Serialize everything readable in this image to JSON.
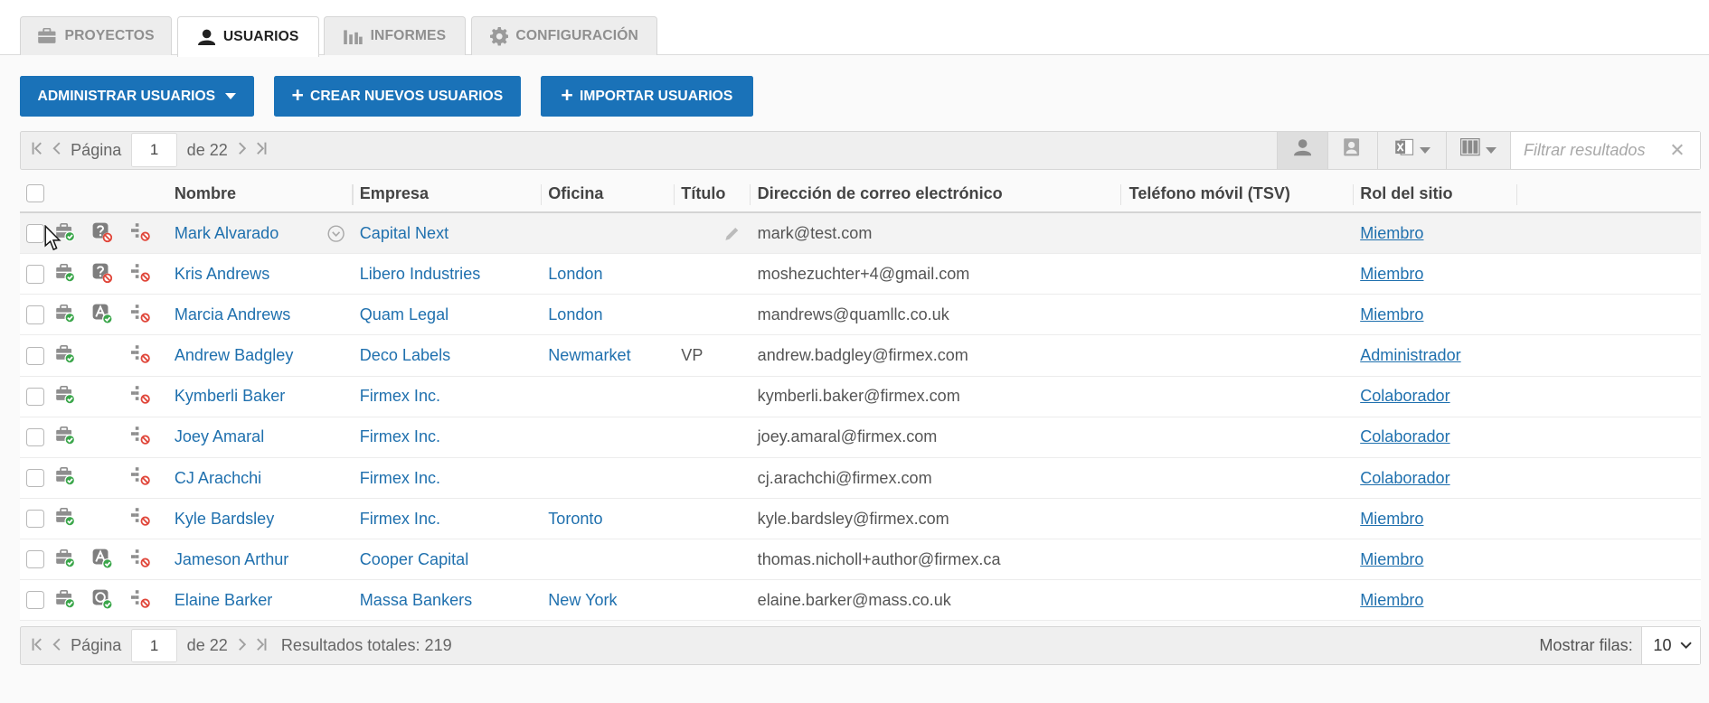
{
  "tabs": [
    {
      "label": "PROYECTOS",
      "icon": "briefcase-icon",
      "active": false
    },
    {
      "label": "USUARIOS",
      "icon": "user-icon",
      "active": true
    },
    {
      "label": "INFORMES",
      "icon": "bar-chart-icon",
      "active": false
    },
    {
      "label": "CONFIGURACIÓN",
      "icon": "gear-icon",
      "active": false
    }
  ],
  "actions": {
    "manage_label": "ADMINISTRAR USUARIOS",
    "create_label": "CREAR NUEVOS USUARIOS",
    "import_label": "IMPORTAR USUARIOS"
  },
  "pager_top": {
    "page_label": "Página",
    "page_value": "1",
    "of_label": "de 22"
  },
  "toolbar": {
    "filter_placeholder": "Filtrar resultados",
    "clear_glyph": "✕"
  },
  "columns": {
    "name": "Nombre",
    "company": "Empresa",
    "office": "Oficina",
    "title": "Título",
    "email": "Dirección de correo electrónico",
    "phone": "Teléfono móvil (TSV)",
    "role": "Rol del sitio"
  },
  "rows": [
    {
      "name": "Mark Alvarado",
      "company": "Capital Next",
      "office": "",
      "title": "",
      "email": "mark@test.com",
      "phone": "",
      "role": "Miembro",
      "status": "inactive"
    },
    {
      "name": "Kris Andrews",
      "company": "Libero Industries",
      "office": "London",
      "title": "",
      "email": "moshezuchter+4@gmail.com",
      "phone": "",
      "role": "Miembro",
      "status": "inactive"
    },
    {
      "name": "Marcia Andrews",
      "company": "Quam Legal",
      "office": "London",
      "title": "",
      "email": "mandrews@quamllc.co.uk",
      "phone": "",
      "role": "Miembro",
      "status": "author"
    },
    {
      "name": "Andrew Badgley",
      "company": "Deco Labels",
      "office": "Newmarket",
      "title": "VP",
      "email": "andrew.badgley@firmex.com",
      "phone": "",
      "role": "Administrador",
      "status": "none"
    },
    {
      "name": "Kymberli Baker",
      "company": "Firmex Inc.",
      "office": "",
      "title": "",
      "email": "kymberli.baker@firmex.com",
      "phone": "",
      "role": "Colaborador",
      "status": "none"
    },
    {
      "name": "Joey Amaral",
      "company": "Firmex Inc.",
      "office": "",
      "title": "",
      "email": "joey.amaral@firmex.com",
      "phone": "",
      "role": "Colaborador",
      "status": "none"
    },
    {
      "name": "CJ Arachchi",
      "company": "Firmex Inc.",
      "office": "",
      "title": "",
      "email": "cj.arachchi@firmex.com",
      "phone": "",
      "role": "Colaborador",
      "status": "none"
    },
    {
      "name": "Kyle Bardsley",
      "company": "Firmex Inc.",
      "office": "Toronto",
      "title": "",
      "email": "kyle.bardsley@firmex.com",
      "phone": "",
      "role": "Miembro",
      "status": "none"
    },
    {
      "name": "Jameson Arthur",
      "company": "Cooper Capital",
      "office": "",
      "title": "",
      "email": "thomas.nicholl+author@firmex.ca",
      "phone": "",
      "role": "Miembro",
      "status": "author"
    },
    {
      "name": "Elaine Barker",
      "company": "Massa Bankers",
      "office": "New York",
      "title": "",
      "email": "elaine.barker@mass.co.uk",
      "phone": "",
      "role": "Miembro",
      "status": "verified"
    }
  ],
  "pager_bottom": {
    "page_label": "Página",
    "page_value": "1",
    "of_label": "de 22",
    "total_label": "Resultados totales: 219",
    "rows_label": "Mostrar filas:",
    "rows_value": "10"
  },
  "colors": {
    "primary": "#1a72b8",
    "link": "#1f70ae",
    "green_check": "#3aa64a",
    "red_block": "#e0463a"
  }
}
